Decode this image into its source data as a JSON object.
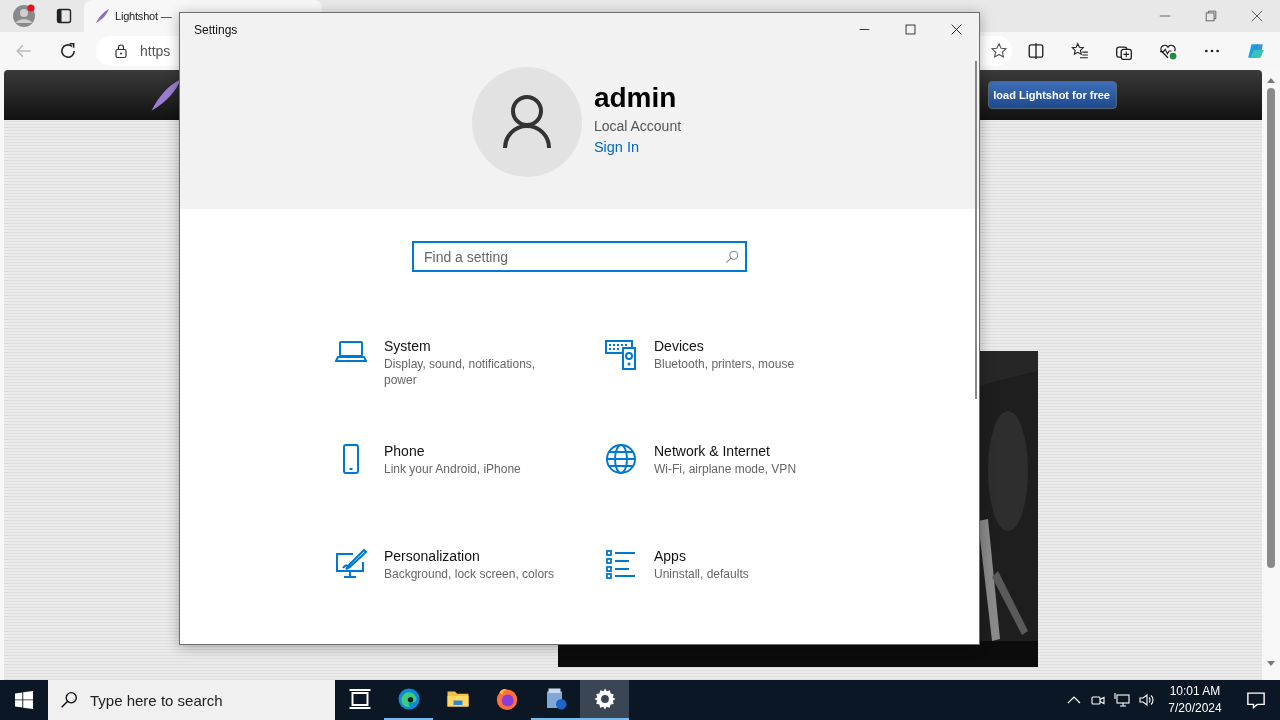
{
  "browser": {
    "tab": {
      "title": "Lightshot —",
      "selected": true
    },
    "address": "https",
    "page": {
      "download_button": "load Lightshot for free"
    }
  },
  "settings_window": {
    "title": "Settings",
    "account": {
      "name": "admin",
      "type": "Local Account",
      "link": "Sign In"
    },
    "search": {
      "placeholder": "Find a setting"
    },
    "categories": [
      {
        "kind": "system",
        "title": "System",
        "description": "Display, sound, notifications, power"
      },
      {
        "kind": "devices",
        "title": "Devices",
        "description": "Bluetooth, printers, mouse"
      },
      {
        "kind": "phone",
        "title": "Phone",
        "description": "Link your Android, iPhone"
      },
      {
        "kind": "network",
        "title": "Network & Internet",
        "description": "Wi-Fi, airplane mode, VPN"
      },
      {
        "kind": "personalization",
        "title": "Personalization",
        "description": "Background, lock screen, colors"
      },
      {
        "kind": "apps",
        "title": "Apps",
        "description": "Uninstall, defaults"
      }
    ]
  },
  "taskbar": {
    "search": {
      "placeholder": "Type here to search"
    },
    "apps": [
      {
        "kind": "taskview",
        "running": false,
        "selected": false
      },
      {
        "kind": "edge",
        "running": true,
        "selected": false
      },
      {
        "kind": "explorer",
        "running": false,
        "selected": false
      },
      {
        "kind": "firefox",
        "running": false,
        "selected": false
      },
      {
        "kind": "installer",
        "running": true,
        "selected": false
      },
      {
        "kind": "settings",
        "running": true,
        "selected": true
      }
    ],
    "clock": {
      "time": "10:01 AM",
      "date": "7/20/2024"
    }
  }
}
